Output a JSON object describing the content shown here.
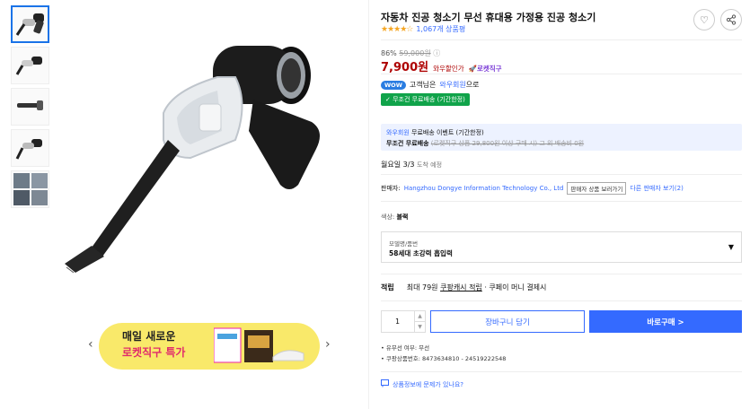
{
  "product": {
    "title": "자동차 진공 청소기 무선 휴대용 가정용 진공 청소기",
    "stars": "★★★★☆",
    "review_count": "1,067개 상품평",
    "discount_rate": "86%",
    "original_price": "59,000원",
    "info_icon": "ⓘ",
    "price": "7,900원",
    "price_label": "와우할인가",
    "rocket_label": "로켓직구"
  },
  "wow": {
    "badge": "WOW",
    "text_prefix": "고객님은",
    "link": "와우회원",
    "text_suffix": "으로"
  },
  "shipping_badge": "✓ 무조건 무료배송 (기간한정)",
  "promo": {
    "line1_blue": "와우회원",
    "line1_rest": "무료배송 이벤트 (기간한정)",
    "line2_bold": "무조건 무료배송",
    "line2_strike": "(로켓직구 상품 29,800원 이상 구매 시) 그 외 배송비 0원"
  },
  "arrival": {
    "date": "월요일 3/3",
    "note": "도착 예정"
  },
  "seller": {
    "label": "판매자:",
    "name": "Hangzhou Dongye Information Technology Co., Ltd",
    "more_button": "판매자 상품 보러가기",
    "other_sellers": "다른 판매자 보기(2)"
  },
  "color": {
    "label": "색상:",
    "value": "블랙"
  },
  "option": {
    "label": "모델명/품번",
    "value": "58세대 초강력 흡입력"
  },
  "points": {
    "label": "적립",
    "text_prefix": "최대 79원",
    "link": "쿠팡캐시 적립",
    "text_suffix": "· 쿠페이 머니 결제시"
  },
  "quantity": "1",
  "buttons": {
    "cart": "장바구니 담기",
    "buy": "바로구매 >"
  },
  "meta": {
    "line1": "• 유무선 여부: 무선",
    "line2": "• 쿠팡상품번호: 8473634810 - 24519222548"
  },
  "report_link": "상품정보에 문제가 있나요?",
  "banner": {
    "line1": "매일 새로운",
    "line2": "로켓직구 특가"
  },
  "colors": {
    "accent": "#346aff",
    "price": "#ae0000",
    "green": "#10a34a"
  }
}
